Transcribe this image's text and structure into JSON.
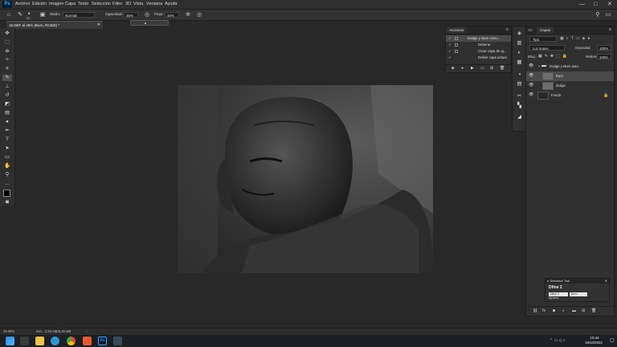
{
  "app": {
    "logo": "Ps"
  },
  "menu": [
    "Archivo",
    "Edición",
    "Imagen",
    "Capa",
    "Texto",
    "Selección",
    "Filtro",
    "3D",
    "Vista",
    "Ventana",
    "Ayuda"
  ],
  "window_controls": {
    "minimize": "—",
    "maximize": "□",
    "close": "✕"
  },
  "options": {
    "brush_size": "91",
    "mode_label": "Modo:",
    "mode_value": "Normal",
    "opacity_label": "Opacidad:",
    "opacity_value": "36%",
    "flow_label": "Flujo:",
    "flow_value": "40%"
  },
  "document_tab": "16.NEF al 49% (Burn, RGB/8) *",
  "actions_panel": {
    "tab": "Acciones",
    "items": [
      {
        "name": "Dodge y Burn Actio...",
        "selected": true
      },
      {
        "name": "Deberar",
        "selected": false
      },
      {
        "name": "Crear capa de aj...",
        "selected": false
      },
      {
        "name": "Definir capa actual",
        "selected": false
      }
    ]
  },
  "layers_panel": {
    "tab_inactive": "3D",
    "tab_active": "Capas",
    "kind_label": "Tipo",
    "blend_mode": "Luz suave",
    "opacity_label": "Opacidad:",
    "opacity_value": "100%",
    "lock_label": "Bloq.:",
    "fill_label": "Relleno:",
    "fill_value": "100%",
    "layers": [
      {
        "name": "Dodge y Burn auto.",
        "type": "group",
        "selected": false
      },
      {
        "name": "Burn",
        "type": "layer",
        "selected": true
      },
      {
        "name": "dodge",
        "type": "layer",
        "selected": false
      },
      {
        "name": "Fondo",
        "type": "background",
        "selected": false
      }
    ]
  },
  "selective_tool": {
    "title": "Selective Tool",
    "dfine": "Dfine 2",
    "field1": "Dfine 2",
    "field2": "Ajustes",
    "field3": "Zero..."
  },
  "status": {
    "zoom": "49.09%",
    "doc": "Doc.: 2,80 MB/8,35 MB"
  },
  "taskbar": {
    "time": "10:44",
    "date": "19/10/2022"
  },
  "colors": {
    "ui_bg": "#282828",
    "panel_bg": "#303030",
    "ps_blue": "#31a8ff"
  }
}
